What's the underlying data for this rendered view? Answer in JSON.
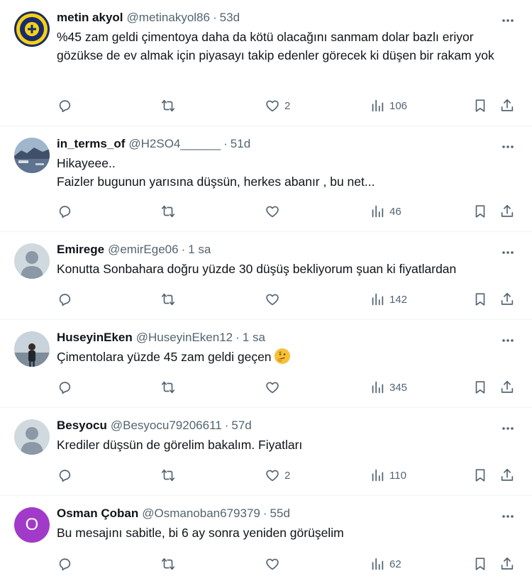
{
  "tweets": [
    {
      "name": "metin akyol",
      "handle": "@metinakyol86",
      "time": "53d",
      "text": "%45 zam geldi çimentoya daha da kötü olacağını sanmam dolar bazlı eriyor gözükse de ev almak için piyasayı takip edenler görecek ki düşen bir rakam yok",
      "replies": "",
      "retweets": "",
      "likes": "2",
      "views": "106",
      "avatar": "team-logo-avatar"
    },
    {
      "name": "in_terms_of",
      "handle": "@H2SO4______",
      "time": "51d",
      "text": "Hikayeee..\nFaizler bugunun yarısına düşsün, herkes abanır , bu net...",
      "replies": "",
      "retweets": "",
      "likes": "",
      "views": "46",
      "avatar": "landscape-avatar"
    },
    {
      "name": "Emirege",
      "handle": "@emirEge06",
      "time": "1 sa",
      "text": "Konutta Sonbahara doğru yüzde 30 düşüş bekliyorum şuan ki fiyatlardan",
      "replies": "",
      "retweets": "",
      "likes": "",
      "views": "142",
      "avatar": "default-avatar"
    },
    {
      "name": "HuseyinEken",
      "handle": "@HuseyinEken12",
      "time": "1 sa",
      "text": "Çimentolara yüzde 45 zam geldi geçen",
      "emoji": "thinking-face-emoji",
      "replies": "",
      "retweets": "",
      "likes": "",
      "views": "345",
      "avatar": "photo-avatar"
    },
    {
      "name": "Besyocu",
      "handle": "@Besyocu79206611",
      "time": "57d",
      "text": "Krediler düşsün de görelim bakalım. Fiyatları",
      "replies": "",
      "retweets": "",
      "likes": "2",
      "views": "110",
      "avatar": "default-avatar"
    },
    {
      "name": "Osman Çoban",
      "handle": "@Osmanoban679379",
      "time": "55d",
      "text": "Bu mesajını sabitle, bi 6 ay sonra yeniden görüşelim",
      "replies": "",
      "retweets": "",
      "likes": "",
      "views": "62",
      "avatar": "letter-avatar",
      "avatar_letter": "O"
    }
  ],
  "separator": "·",
  "colors": {
    "text": "#0f1419",
    "secondary": "#536471",
    "divider": "#eff3f4",
    "letter_avatar_bg": "#a23ac9"
  }
}
